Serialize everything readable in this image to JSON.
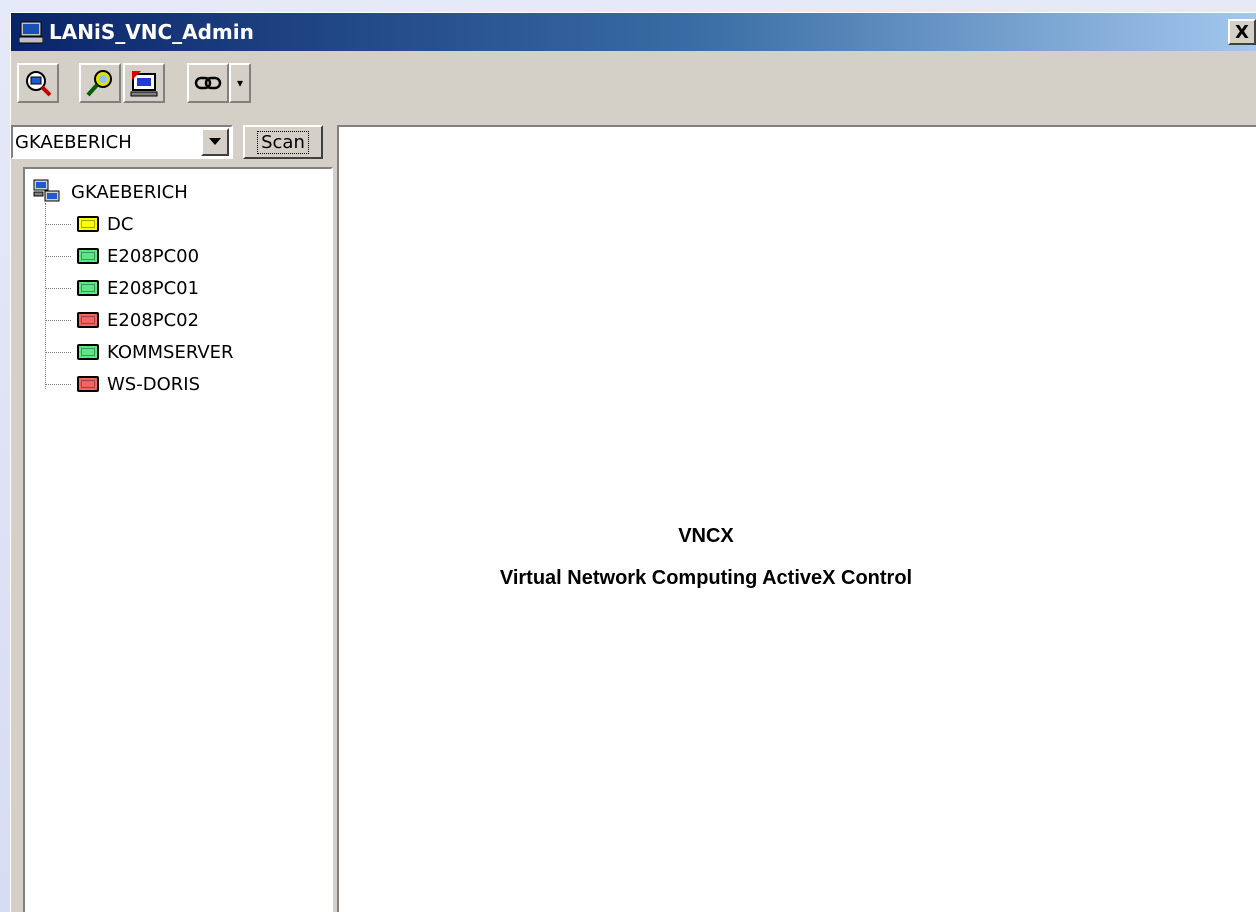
{
  "window": {
    "title": "LANiS_VNC_Admin",
    "close_label": "X"
  },
  "toolbar": {
    "buttons": [
      {
        "icon": "search-computer-icon"
      },
      {
        "icon": "find-icon"
      },
      {
        "icon": "remote-screen-icon"
      },
      {
        "icon": "link-icon"
      }
    ],
    "dropdown_glyph": "▾"
  },
  "domain_select": {
    "value": "GKAEBERICH",
    "arrow": "▼"
  },
  "scan_button": {
    "label": "Scan"
  },
  "tree": {
    "root": {
      "label": "GKAEBERICH",
      "icon": "network-icon"
    },
    "items": [
      {
        "label": "DC",
        "status_color": "#ffff00"
      },
      {
        "label": "E208PC00",
        "status_color": "#5ce685"
      },
      {
        "label": "E208PC01",
        "status_color": "#5ce685"
      },
      {
        "label": "E208PC02",
        "status_color": "#f06464"
      },
      {
        "label": "KOMMSERVER",
        "status_color": "#5ce685"
      },
      {
        "label": "WS-DORIS",
        "status_color": "#f06464"
      }
    ]
  },
  "viewer": {
    "title": "VNCX",
    "subtitle": "Virtual Network Computing ActiveX Control"
  }
}
